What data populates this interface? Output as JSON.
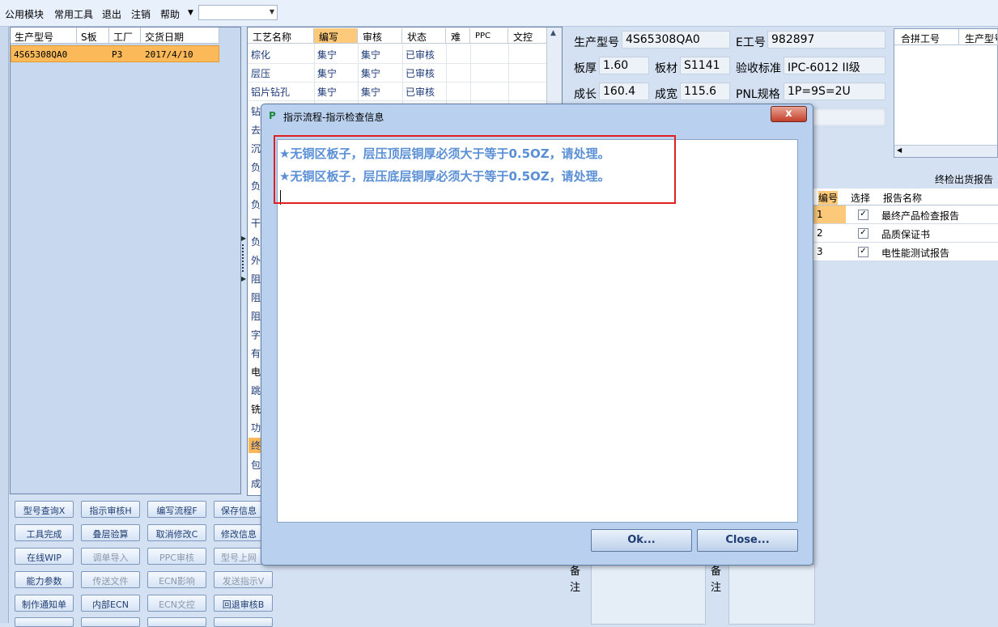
{
  "menu": {
    "items": [
      "公用模块",
      "常用工具",
      "退出",
      "注销",
      "帮助"
    ],
    "combo_value": ""
  },
  "left_grid": {
    "headers": [
      "生产型号",
      "S板",
      "工厂",
      "交货日期"
    ],
    "row": {
      "model": "4S65308QA0",
      "s_board": "",
      "factory": "P3",
      "date": "2017/4/10"
    }
  },
  "buttons": [
    [
      "型号查询X",
      "指示审核H",
      "编写流程F",
      "保存信息"
    ],
    [
      "工具完成",
      "叠层验算",
      "取消修改C",
      "修改信息"
    ],
    [
      "在线WIP",
      "调单导入",
      "PPC审核",
      "型号上网"
    ],
    [
      "能力参数",
      "传送文件",
      "ECN影响",
      "发送指示V"
    ],
    [
      "制作通知单",
      "内部ECN",
      "ECN文控",
      "回退审核B"
    ]
  ],
  "process_grid": {
    "headers": [
      "工艺名称",
      "编写",
      "审核",
      "状态",
      "难",
      "PPC",
      "文控"
    ],
    "rows": [
      {
        "name": "棕化",
        "writer": "集宁",
        "reviewer": "集宁",
        "status": "已审核"
      },
      {
        "name": "层压",
        "writer": "集宁",
        "reviewer": "集宁",
        "status": "已审核"
      },
      {
        "name": "铝片钻孔",
        "writer": "集宁",
        "reviewer": "集宁",
        "status": "已审核"
      }
    ],
    "partial_labels": [
      "钻",
      "去",
      "沉",
      "负",
      "负",
      "负",
      "干",
      "负",
      "外",
      "阻",
      "阻",
      "阻",
      "字",
      "有",
      "电",
      "跳",
      "铣",
      "功",
      "终",
      "包",
      "成"
    ]
  },
  "info": {
    "model_label": "生产型号",
    "model_value": "4S65308QA0",
    "eno_label": "E工号",
    "eno_value": "982897",
    "thickness_label": "板厚",
    "thickness_value": "1.60",
    "material_label": "板材",
    "material_value": "S1141",
    "standard_label": "验收标准",
    "standard_value": "IPC-6012 II级",
    "length_label": "成长",
    "length_value": "160.4",
    "width_label": "成宽",
    "width_value": "115.6",
    "pnl_label": "PNL规格",
    "pnl_value": "1P=9S=2U"
  },
  "combine_grid": {
    "headers": [
      "合拼工号",
      "生产型号"
    ]
  },
  "report": {
    "title": "终检出货报告",
    "headers": [
      "编号",
      "选择",
      "报告名称"
    ],
    "rows": [
      {
        "no": "1",
        "checked": "✓",
        "name": "最终产品检查报告"
      },
      {
        "no": "2",
        "checked": "✓",
        "name": "品质保证书"
      },
      {
        "no": "3",
        "checked": "✓",
        "name": "电性能测试报告"
      }
    ]
  },
  "remark": {
    "label_a": "备注",
    "label_b": "备注"
  },
  "dialog": {
    "title": "指示流程-指示检查信息",
    "messages": [
      "★无铜区板子，层压顶层铜厚必须大于等于0.5OZ，请处理。",
      "★无铜区板子，层压底层铜厚必须大于等于0.5OZ，请处理。"
    ],
    "ok_label": "Ok...",
    "close_label": "Close...",
    "close_x": "x"
  },
  "colors": {
    "accent": "#5a8fd6",
    "selection": "#fcb95a",
    "highlight_box": "#e02020"
  }
}
